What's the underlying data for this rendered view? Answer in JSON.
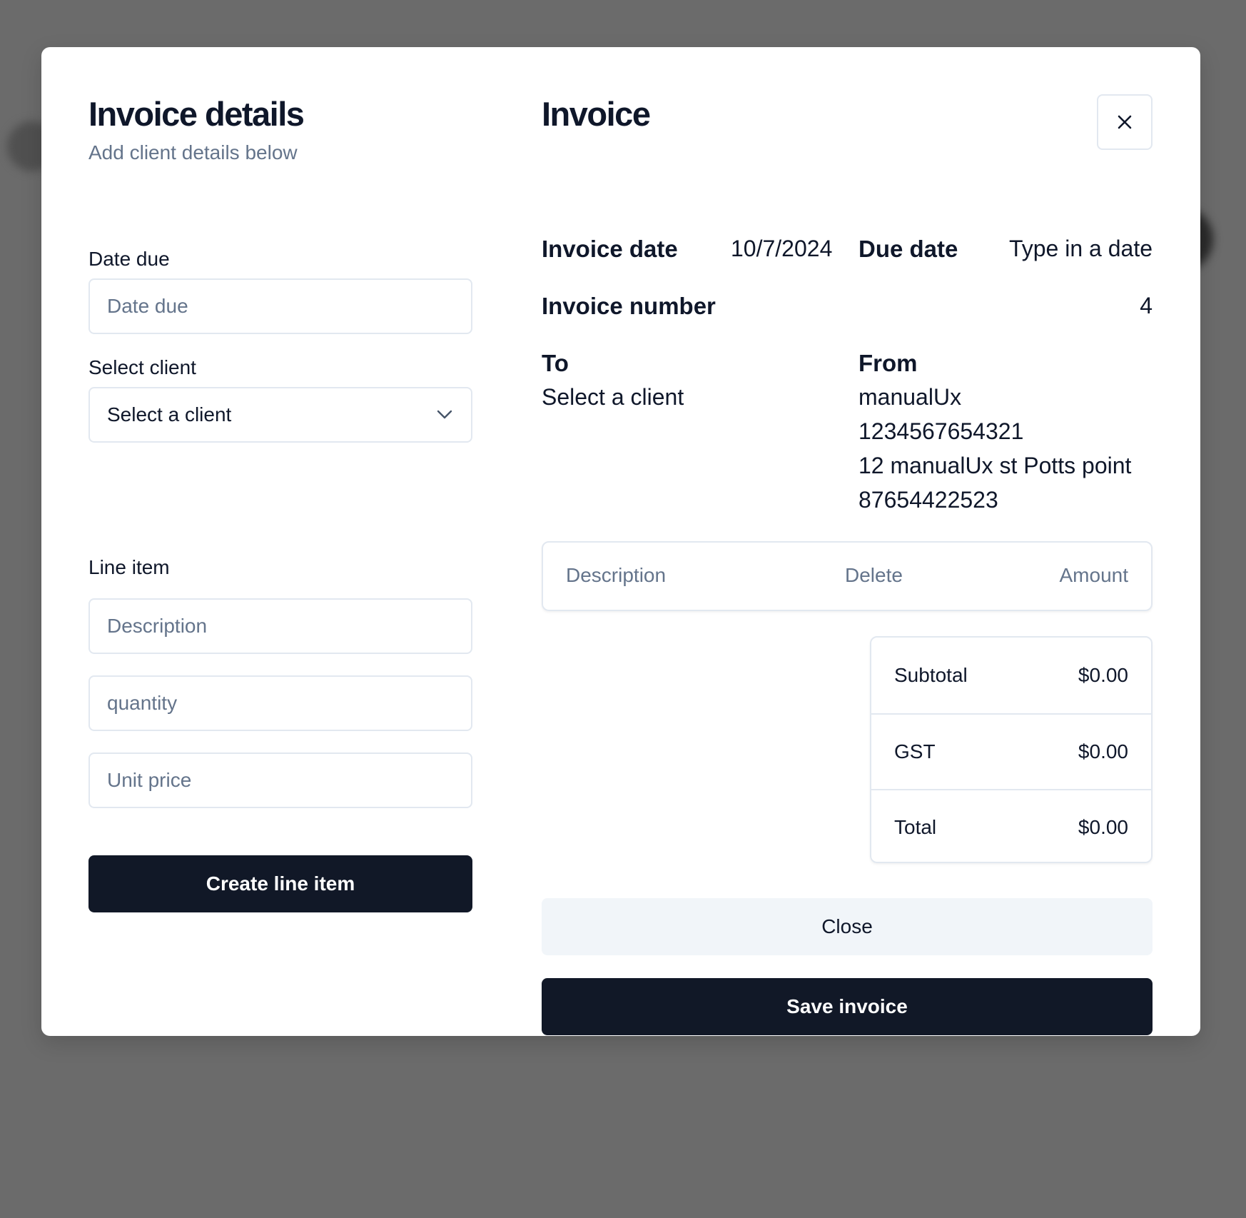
{
  "details": {
    "title": "Invoice details",
    "subtitle": "Add client details below",
    "date_due_label": "Date due",
    "date_due_placeholder": "Date due",
    "select_client_label": "Select client",
    "select_client_value": "Select a client",
    "line_item_label": "Line item",
    "description_placeholder": "Description",
    "quantity_placeholder": "quantity",
    "unit_price_placeholder": "Unit price",
    "create_button": "Create line item"
  },
  "invoice": {
    "title": "Invoice",
    "invoice_date_label": "Invoice date",
    "invoice_date_value": "10/7/2024",
    "due_date_label": "Due date",
    "due_date_value": "Type in a date",
    "invoice_number_label": "Invoice number",
    "invoice_number_value": "4",
    "to_label": "To",
    "to_value": "Select a client",
    "from_label": "From",
    "from_lines": [
      "manualUx",
      "1234567654321",
      "12 manualUx st Potts point",
      "87654422523"
    ],
    "table_headers": [
      "Description",
      "Delete",
      "Amount"
    ],
    "totals": [
      {
        "label": "Subtotal",
        "value": "$0.00"
      },
      {
        "label": "GST",
        "value": "$0.00"
      },
      {
        "label": "Total",
        "value": "$0.00"
      }
    ],
    "close_button": "Close",
    "save_button": "Save invoice"
  },
  "icons": {
    "close": "close-icon",
    "chevron": "chevron-down-icon"
  }
}
